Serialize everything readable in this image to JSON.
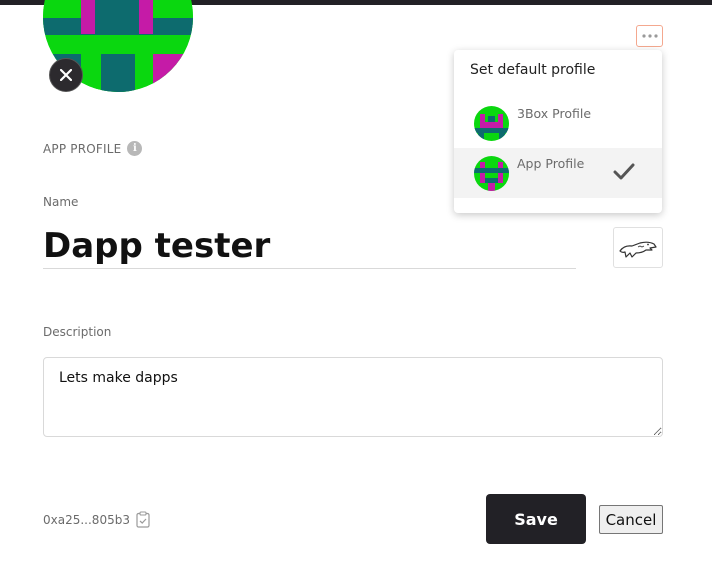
{
  "profile": {
    "section_label": "APP PROFILE",
    "name_label": "Name",
    "name_value": "Dapp tester",
    "description_label": "Description",
    "description_value": "Lets make dapps",
    "address": "0xa25...805b3"
  },
  "actions": {
    "save_label": "Save",
    "cancel_label": "Cancel"
  },
  "dropdown": {
    "title": "Set default profile",
    "items": [
      {
        "label": "3Box Profile",
        "selected": false
      },
      {
        "label": "App Profile",
        "selected": true
      }
    ]
  },
  "icons": {
    "remove_avatar": "close-icon",
    "more": "more-horizontal-icon",
    "info": "info-icon",
    "emoji": "crocodile-icon",
    "copy": "clipboard-icon",
    "check": "check-icon"
  },
  "colors": {
    "avatar_green": "#0ad70f",
    "avatar_teal": "#0d6b6e",
    "avatar_magenta": "#c51ba7",
    "dark": "#222126",
    "more_border": "#f4a88f"
  }
}
